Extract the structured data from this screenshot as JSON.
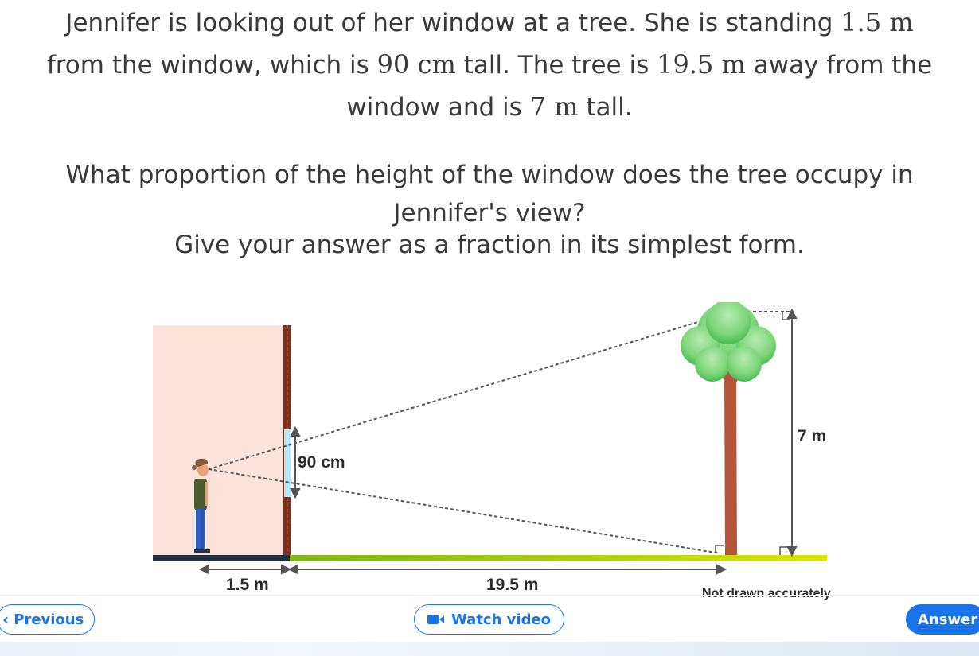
{
  "question": {
    "p1_a": "Jennifer is looking out of her window at a tree. She is standing ",
    "m1": "1.5 m",
    "p1_b": "from the window, which is ",
    "m2": "90 cm",
    "p1_c": " tall. The tree is ",
    "m3": "19.5 m",
    "p1_d": " away from the",
    "p1_e": "window and is ",
    "m4": "7 m",
    "p1_f": " tall.",
    "p2_a": "What proportion of the height of the window does the tree occupy in",
    "p2_b": "Jennifer's view?",
    "p3": "Give your answer as a fraction in its simplest form."
  },
  "diagram": {
    "label_window": "90 cm",
    "label_tree_height": "7 m",
    "label_dist_person": "1.5 m",
    "label_dist_tree": "19.5 m",
    "note": "Not drawn accurately"
  },
  "nav": {
    "prev_label": "Previous",
    "video_label": "Watch video",
    "answer_label": "Answer"
  },
  "colors": {
    "accent": "#1a73e8",
    "wall": "#fde3da",
    "grass": "#c6dd10",
    "trunk": "#b5563a",
    "foliage": "#7bd67b"
  }
}
